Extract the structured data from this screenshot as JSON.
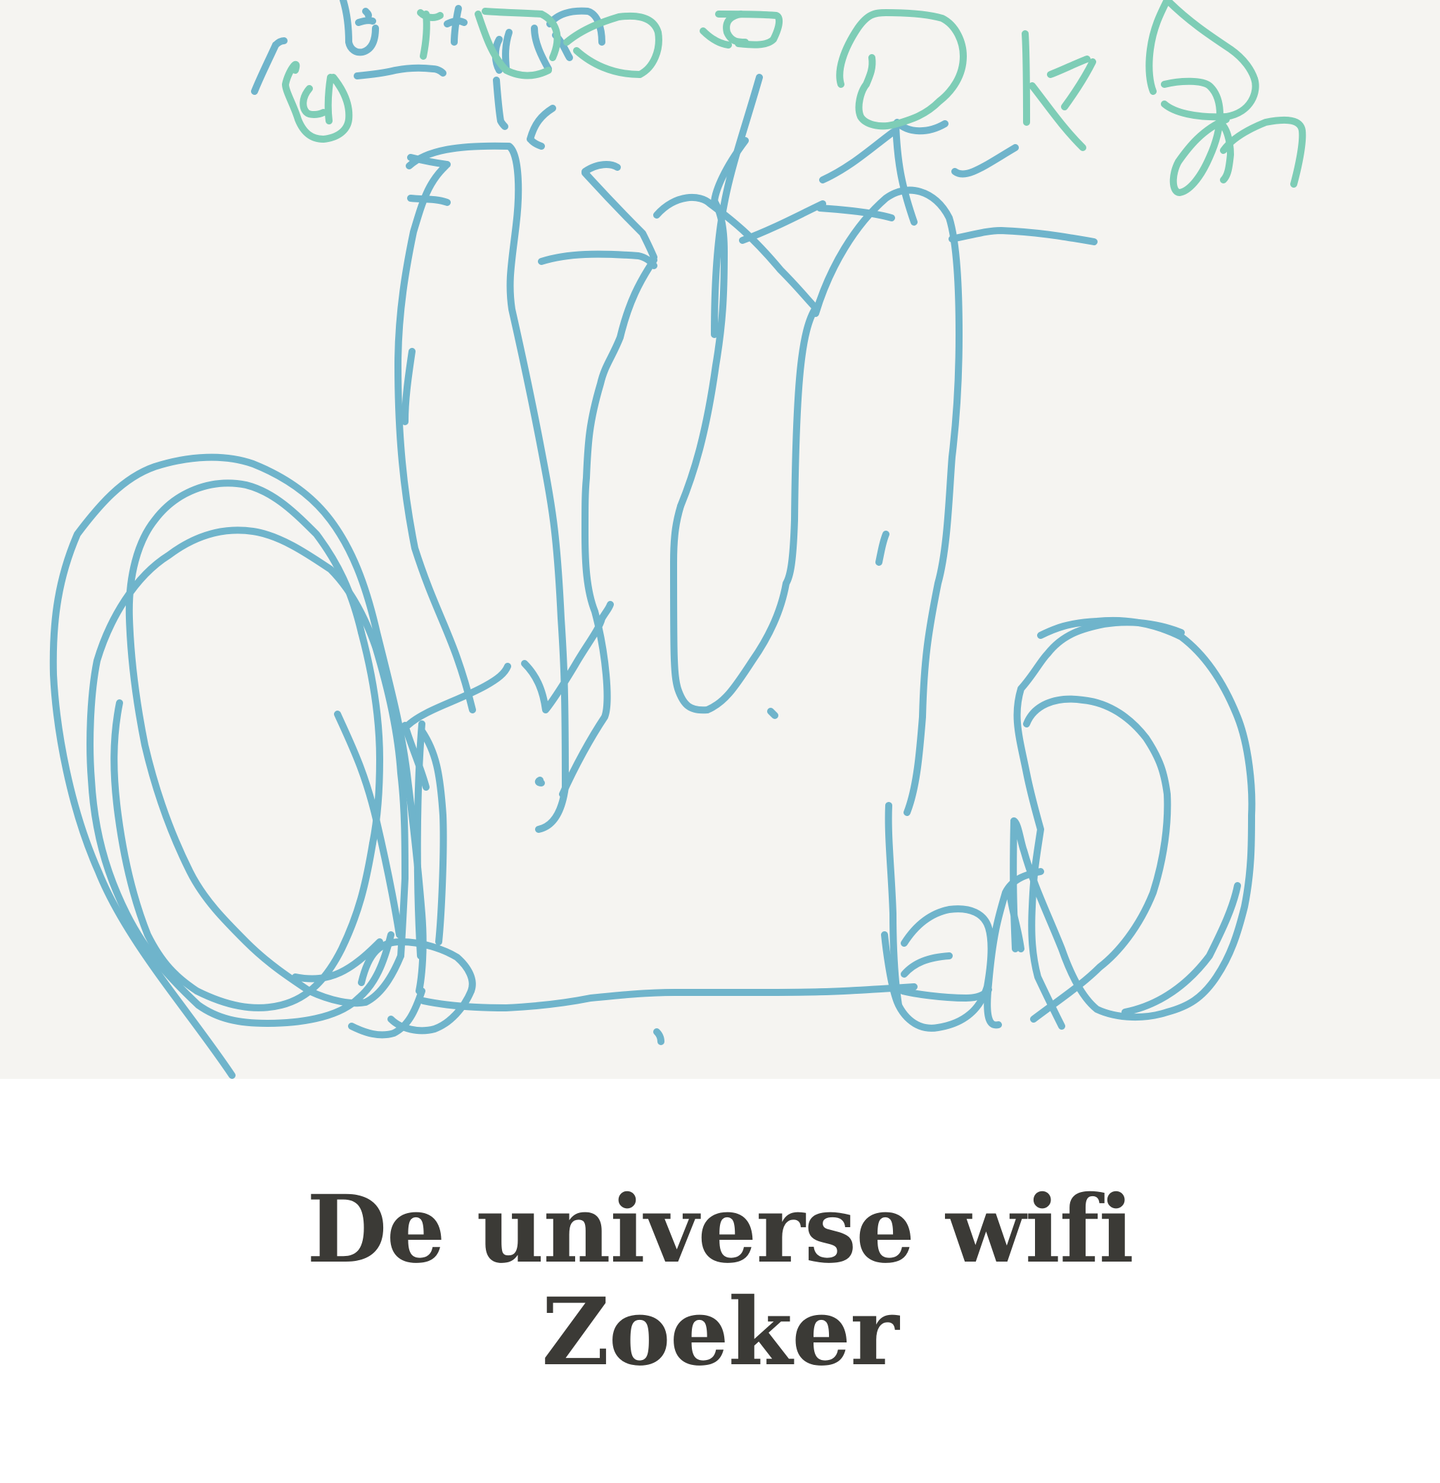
{
  "drawing": {
    "background_color": "#f5f4f1",
    "stroke_colors": [
      "#6fb4cb",
      "#7ecdb6"
    ],
    "strokes_blue": [
      "M582 236 C606 214 650 206 724 208 C738 218 740 270 734 320 C728 372 722 400 728 440 C742 502 752 548 766 620 C786 724 792 756 798 880 C802 940 804 980 804 1120",
      "M804 1120 C800 1150 790 1175 766 1180",
      "M634 236 C608 260 600 290 588 330 C578 378 566 444 566 520 C566 620 574 700 590 780 C622 880 646 904 672 1010",
      "M584 224 C600 228 620 232 636 234",
      "M584 282 C600 284 620 282 636 288",
      "M832 244 C850 232 868 232 878 238",
      "M770 372 C808 360 852 360 908 364 C918 366 926 372 930 378",
      "M832 246 C852 268 878 296 914 332 C918 340 924 352 930 366",
      "M930 370 C910 400 894 430 882 480 C870 510 860 520 854 546 C838 600 836 630 834 680 C832 700 832 720 832 760 C832 800 834 840 846 870 C862 930 868 1000 860 1020 C840 1050 818 1090 800 1130",
      "M934 306 C960 276 996 276 1010 290 C1040 312 1070 336 1110 384 C1136 410 1150 428 1160 438",
      "M1160 438 C1140 470 1132 540 1130 740 C1128 800 1124 820 1118 830 C1112 864 1098 900 1070 940 C1044 980 1030 1000 1006 1010",
      "M1006 1010 C982 1012 972 1004 964 980 C958 960 958 930 958 800 C958 760 962 740 968 720",
      "M968 720 C986 676 1004 620 1018 520 C1028 460 1030 420 1030 358 C1030 320 1024 300 1016 286",
      "M1016 286 C1018 270 1030 240 1060 200",
      "M1080 110 C1060 180 1040 236 1030 290 C1020 340 1016 400 1016 476",
      "M1166 296 C1196 298 1240 302 1268 310",
      "M1170 290 C1144 302 1104 324 1056 342",
      "M1170 256 C1210 238 1240 210 1270 188",
      "M1160 446 C1180 380 1216 320 1260 282 C1290 260 1330 270 1350 310 C1360 342 1364 400 1364 476 C1364 540 1360 600 1354 650 C1350 700 1348 780 1334 830 C1320 900 1314 940 1312 1020 C1308 1070 1304 1120 1290 1156",
      "M1354 340 C1384 334 1404 328 1424 328 C1474 330 1510 336 1556 344",
      "M1274 176 C1276 230 1282 264 1300 316",
      "M1358 244 C1374 256 1400 236 1444 210",
      "M1276 174 C1292 190 1320 190 1344 176",
      "M1264 1146 C1262 1190 1268 1240 1270 1300 C1270 1340 1272 1390 1278 1430",
      "M600 1030 C592 1130 592 1260 598 1360",
      "M576 1032 C584 1060 598 1090 606 1120",
      "M580 1032 C604 1010 650 998 690 976 C708 966 718 958 722 948",
      "M746 944 C762 960 772 980 776 1010 C784 1000 800 976 818 946 C834 918 852 896 856 880 C862 870 866 866 868 860",
      "M600 1040 C620 1070 626 1100 630 1160 C632 1210 628 1300 624 1340",
      "M602 1424 C640 1432 680 1434 720 1434 C760 1432 800 1428 840 1420 C880 1416 920 1412 960 1412 C1000 1412 1040 1412 1080 1412 C1120 1412 1160 1412 1200 1410 C1240 1408 1270 1406 1300 1404",
      "M1286 1342 C1300 1320 1320 1300 1350 1294 C1380 1290 1400 1300 1406 1320 C1412 1340 1410 1370 1404 1404 C1394 1436 1372 1456 1334 1462 C1300 1468 1280 1440 1274 1420 C1266 1396 1260 1350 1258 1330",
      "M1284 1410 C1300 1414 1340 1420 1374 1420 C1390 1420 1400 1416 1406 1408",
      "M1286 1386 C1300 1370 1320 1362 1350 1360",
      "M1444 1350 C1442 1300 1440 1260 1442 1168",
      "M1420 1458 C1410 1460 1400 1456 1406 1400 C1412 1330 1420 1304 1430 1270 C1440 1250 1460 1244 1480 1240",
      "M1442 1168 C1448 1170 1452 1200 1456 1210 C1470 1260 1490 1300 1510 1350 C1524 1390 1540 1420 1560 1436 C1590 1450 1630 1450 1660 1440 C1690 1432 1710 1420 1730 1390 C1750 1360 1760 1330 1770 1290 C1780 1240 1780 1200 1780 1160 C1782 1120 1776 1060 1760 1020 C1744 980 1720 936 1680 906 C1640 886 1600 880 1560 884 C1520 886 1500 894 1480 904",
      "M1510 1460 C1500 1440 1490 1420 1476 1390 C1468 1360 1466 1330 1468 1290 C1470 1240 1474 1220 1480 1180 C1480 1180 1466 1130 1460 1100 C1450 1050 1440 1020 1452 980 C1470 960 1480 940 1490 930 C1512 902 1540 894 1570 888 C1620 880 1660 892 1680 900",
      "M1470 1450 C1510 1420 1540 1400 1564 1376 C1590 1356 1620 1320 1640 1270 C1656 1220 1662 1170 1660 1130 C1656 1100 1650 1080 1630 1050 C1610 1024 1580 1000 1540 996 C1500 990 1470 1004 1460 1030",
      "M1452 1350 C1448 1320 1440 1300 1436 1270",
      "M1600 1440 C1650 1430 1690 1400 1720 1360 C1740 1320 1754 1290 1760 1260"
    ],
    "loops_left": [
      "M330 1530 C270 1440 180 1340 140 1240 C100 1150 80 1040 76 960 C74 880 84 820 110 760 C140 720 174 680 220 664 C270 648 320 646 360 660 C400 676 440 700 470 740 C500 780 520 830 536 900 C556 980 572 1040 580 1110 C590 1190 596 1250 600 1300 C604 1350 600 1390 596 1410",
      "M600 1410 C590 1440 580 1460 560 1470 C540 1476 520 1470 500 1460",
      "M480 1016 C500 1060 520 1100 536 1170 C550 1230 560 1280 568 1330",
      "M556 1330 C546 1370 534 1400 510 1420 C480 1450 420 1456 380 1456 C340 1456 310 1450 282 1430",
      "M282 1430 C250 1400 210 1360 180 1300 C150 1240 134 1180 130 1110 C126 1060 128 990 138 940 C156 880 192 820 240 790 C280 760 320 750 360 756 C400 762 440 790 470 810 C500 840 520 880 534 920",
      "M534 920 C552 980 566 1040 570 1100 C576 1150 576 1200 576 1250 C574 1290 572 1330 570 1360",
      "M570 1360 C556 1394 540 1416 520 1426 C500 1430 470 1424 440 1410",
      "M440 1410 C410 1390 380 1370 350 1340 C320 1310 290 1280 270 1240 C240 1180 220 1120 206 1060 C194 1000 186 940 184 880 C182 820 196 770 220 740 C250 700 300 680 350 690 C390 700 420 730 450 760 C480 800 500 840 514 900",
      "M514 900 C530 960 540 1020 540 1080 C540 1130 536 1170 530 1200",
      "M530 1200 C520 1260 510 1300 486 1350 C466 1390 440 1420 400 1430 C360 1440 320 1430 280 1410",
      "M280 1410 C250 1390 230 1370 210 1330 C190 1280 176 1220 168 1160 C160 1100 160 1050 170 1000",
      "M420 1390 C470 1400 500 1380 540 1340",
      "M514 1398 C524 1356 540 1340 570 1340 C600 1340 630 1350 650 1362 C666 1376 676 1394 670 1410",
      "M670 1410 C660 1434 640 1456 618 1464 C596 1470 570 1464 556 1450"
    ],
    "strokes_green": [
      "M606 20 C608 40 606 60 602 80",
      "M598 18 C604 24 616 28 626 22",
      "M680 20 C690 50 700 80 720 100 C740 110 760 110 780 100",
      "M690 16 C714 18 740 18 770 20",
      "M770 20 C790 30 800 50 786 82",
      "M806 60 C830 40 860 30 880 24 C910 20 930 26 936 46 C940 70 930 96 910 106",
      "M910 106 C870 106 840 90 820 72",
      "M1000 44 C1010 54 1022 62 1036 64",
      "M1022 20 C1050 20 1080 20 1104 22 C1110 24 1110 36 1100 56 C1090 66 1070 64 1050 62",
      "M1054 20 C1040 22 1030 30 1034 46 C1040 60 1050 60 1060 60",
      "M1196 120 C1190 100 1200 70 1220 40 C1234 20 1244 18 1260 18 C1290 18 1320 20 1340 26 C1360 36 1370 60 1370 80",
      "M1370 80 C1370 108 1354 130 1336 144 C1316 164 1296 170 1276 176 C1250 184 1230 176 1224 166 C1218 152 1224 130 1232 120",
      "M1232 120 C1238 106 1242 96 1240 82",
      "M1458 48 C1460 80 1460 140 1460 174",
      "M1468 122 C1490 150 1510 180 1540 210",
      "M1494 106 C1510 100 1530 90 1546 84",
      "M1514 152 C1530 130 1544 108 1554 88",
      "M1660 0 C1650 20 1640 40 1636 70 C1632 100 1636 120 1640 130",
      "M1660 0 C1690 30 1720 50 1750 70 C1770 84 1780 100 1784 112",
      "M1784 112 C1790 130 1780 160 1744 166 C1700 168 1670 160 1656 148",
      "M1656 120 C1680 114 1710 114 1720 122 C1740 140 1740 180 1720 224 C1706 256 1690 272 1678 274 C1666 274 1666 248 1676 230",
      "M1676 230 C1690 210 1710 184 1744 170",
      "M1736 176 C1744 180 1750 200 1750 220 C1748 240 1746 250 1740 256",
      "M1740 214 C1750 200 1770 186 1800 174 C1830 168 1850 170 1852 186 C1854 204 1846 240 1840 262",
      "M420 100 C426 80 410 100 406 120 C406 130 418 150 424 170 C432 190 444 198 460 198 C480 196 494 186 496 170 C498 150 490 130 474 110",
      "M470 110 C466 136 466 156 468 172",
      "M440 126 C428 140 430 154 436 160 C440 164 452 164 460 160"
    ],
    "strokes_blue_top": [
      "M362 130 C370 110 380 90 392 64",
      "M392 64 C396 60 400 58 404 58",
      "M488 0 C494 20 496 40 496 60 C498 70 506 76 516 74 C530 70 534 56 534 40",
      "M530 30 C524 28 516 30 510 32",
      "M520 16 C522 18 524 20 524 22",
      "M508 108 C530 106 546 104 562 100 C582 96 600 96 616 98 C620 98 626 100 630 104",
      "M652 12 C648 30 646 50 646 60",
      "M636 34 C644 30 652 28 660 32",
      "M724 46 C716 70 720 90 720 100",
      "M710 56 C702 70 704 90 710 100",
      "M706 114 C708 140 710 160 712 172 C714 176 716 178 718 180",
      "M754 198 C760 176 770 164 786 154",
      "M756 200 C760 204 764 206 770 208",
      "M782 34 C792 20 812 14 836 16 C850 20 856 40 856 60",
      "M790 50 C800 60 806 76 810 82",
      "M760 40 C760 60 770 80 780 98",
      "M586 500 C580 540 576 570 576 600",
      "M1250 800 C1254 780 1256 770 1260 760",
      "M1096 1012 C1098 1014 1100 1016 1102 1018",
      "M934 1468 C938 1472 940 1476 940 1482",
      "M768 1110 C764 1112 766 1114 770 1114"
    ]
  },
  "title": {
    "line1": "De universe wifi",
    "line2": "Zoeker"
  }
}
